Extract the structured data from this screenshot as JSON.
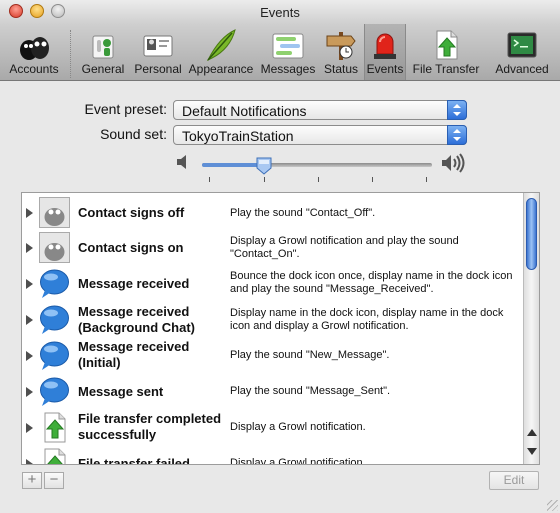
{
  "window": {
    "title": "Events"
  },
  "toolbar": {
    "items": [
      {
        "label": "Accounts",
        "icon": "accounts-icon"
      },
      {
        "label": "General",
        "icon": "general-switch-icon"
      },
      {
        "label": "Personal",
        "icon": "personal-card-icon"
      },
      {
        "label": "Appearance",
        "icon": "feather-icon"
      },
      {
        "label": "Messages",
        "icon": "messages-icon"
      },
      {
        "label": "Status",
        "icon": "status-signpost-icon"
      },
      {
        "label": "Events",
        "icon": "siren-icon"
      },
      {
        "label": "File Transfer",
        "icon": "file-transfer-icon"
      },
      {
        "label": "Advanced",
        "icon": "advanced-terminal-icon"
      }
    ],
    "selected": "Events"
  },
  "form": {
    "event_preset_label": "Event preset:",
    "event_preset_value": "Default Notifications",
    "sound_set_label": "Sound set:",
    "sound_set_value": "TokyoTrainStation",
    "volume_fraction": 0.27
  },
  "events": [
    {
      "name": "Contact signs off",
      "icon": "contact-shadow-icon",
      "description": "Play the sound \"Contact_Off\"."
    },
    {
      "name": "Contact signs on",
      "icon": "contact-shadow-icon",
      "description": "Display a Growl notification and play the sound \"Contact_On\"."
    },
    {
      "name": "Message received",
      "icon": "speech-bubble-icon",
      "description": "Bounce the dock icon once, display name in the dock icon and play the sound \"Message_Received\"."
    },
    {
      "name": "Message received (Background Chat)",
      "icon": "speech-bubble-icon",
      "description": "Display name in the dock icon, display name in the dock icon and display a Growl notification."
    },
    {
      "name": "Message received (Initial)",
      "icon": "speech-bubble-icon",
      "description": "Play the sound \"New_Message\"."
    },
    {
      "name": "Message sent",
      "icon": "speech-bubble-icon",
      "description": "Play the sound \"Message_Sent\"."
    },
    {
      "name": "File transfer completed successfully",
      "icon": "file-transfer-icon",
      "description": "Display a Growl notification."
    },
    {
      "name": "File transfer failed",
      "icon": "file-transfer-icon",
      "description": "Display a Growl notification."
    }
  ],
  "buttons": {
    "add": "+",
    "remove": "−",
    "edit": "Edit"
  },
  "colors": {
    "accent": "#3a78d8",
    "toolbar_bg": "#bdbdbd",
    "window_bg": "#e8e8e8"
  }
}
